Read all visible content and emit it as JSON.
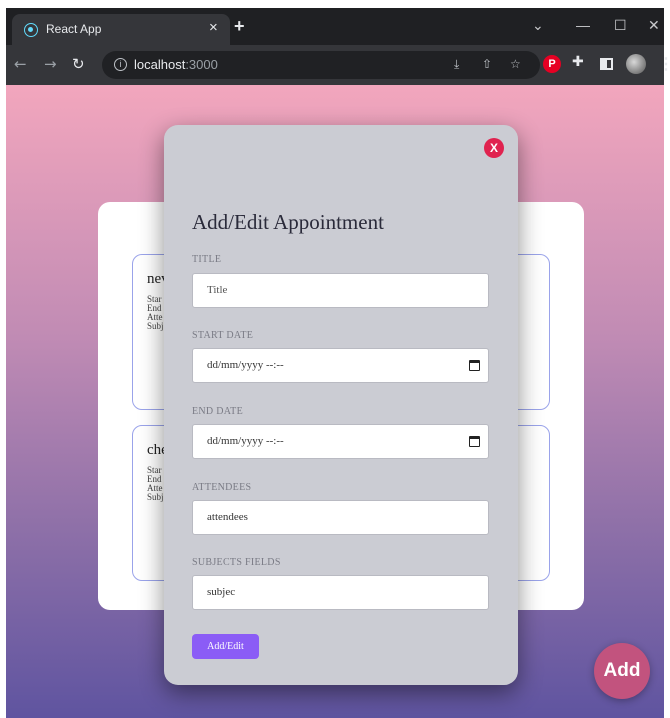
{
  "browser": {
    "tab_title": "React App",
    "tab_close": "×",
    "new_tab": "+",
    "url_host": "localhost",
    "url_port": ":3000",
    "pinterest_glyph": "P"
  },
  "appointments": [
    {
      "title_partial": "nev",
      "lines": [
        "Star",
        "End",
        "Atte",
        "Subj"
      ]
    },
    {
      "title_partial": "che",
      "lines": [
        "Star",
        "End",
        "Atte",
        "Subj"
      ]
    }
  ],
  "modal": {
    "close_label": "X",
    "title": "Add/Edit Appointment",
    "fields": {
      "title": {
        "label": "TITLE",
        "placeholder": "Title"
      },
      "start_date": {
        "label": "START DATE",
        "value": "dd/mm/yyyy --:--"
      },
      "end_date": {
        "label": "END DATE",
        "value": "dd/mm/yyyy --:--"
      },
      "attendees": {
        "label": "ATTENDEES",
        "value": "attendees"
      },
      "subjects": {
        "label": "SUBJECTS FIELDS",
        "value": "subjec"
      }
    },
    "submit_label": "Add/Edit"
  },
  "fab": {
    "label": "Add"
  },
  "colors": {
    "accent_purple": "#8b5cf6",
    "close_red": "#e0224f",
    "card_border": "#9aa3ea",
    "fab_pink": "#c2537e"
  }
}
